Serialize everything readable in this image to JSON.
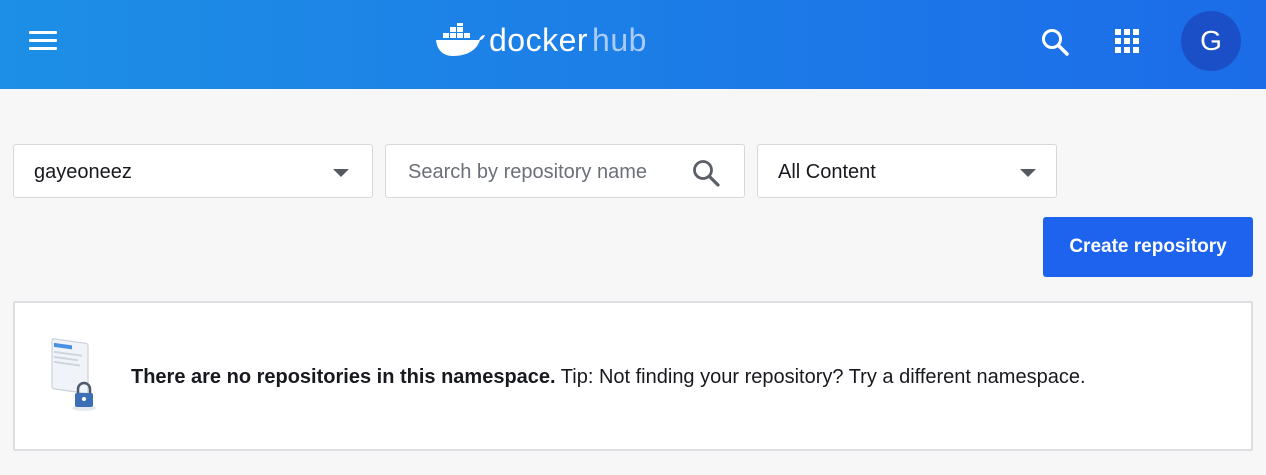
{
  "header": {
    "logo_word1": "docker",
    "logo_word2": "hub",
    "avatar_initial": "G",
    "icons": [
      "menu-icon",
      "docker-whale-icon",
      "search-icon",
      "apps-grid-icon"
    ]
  },
  "filters": {
    "namespace": "gayeoneez",
    "search_placeholder": "Search by repository name",
    "content_filter": "All Content"
  },
  "actions": {
    "create_repository": "Create repository"
  },
  "empty_state": {
    "headline": "There are no repositories in this namespace.",
    "tip": " Tip: Not finding your repository? Try a different namespace."
  },
  "colors": {
    "header_start": "#1d8fe6",
    "header_end": "#1c6ce8",
    "primary": "#1d63ed",
    "avatar_bg": "#1a4fc7"
  }
}
